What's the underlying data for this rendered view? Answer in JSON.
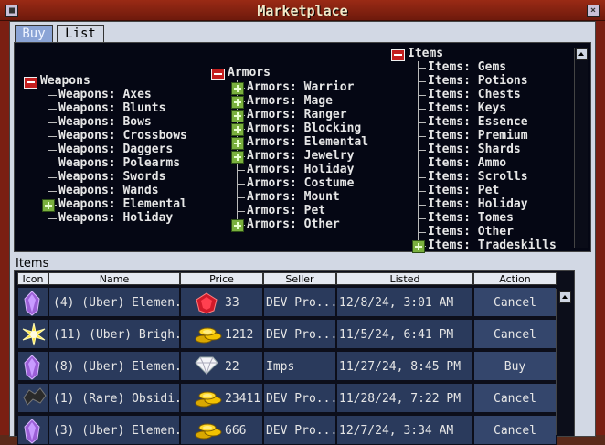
{
  "window": {
    "title": "Marketplace"
  },
  "tabs": [
    {
      "label": "Buy"
    },
    {
      "label": "List"
    }
  ],
  "tree": {
    "weapons": {
      "label": "Weapons",
      "children": [
        "Weapons: Axes",
        "Weapons: Blunts",
        "Weapons: Bows",
        "Weapons: Crossbows",
        "Weapons: Daggers",
        "Weapons: Polearms",
        "Weapons: Swords",
        "Weapons: Wands",
        "Weapons: Elemental",
        "Weapons: Holiday"
      ]
    },
    "armors": {
      "label": "Armors",
      "children": [
        "Armors: Warrior",
        "Armors: Mage",
        "Armors: Ranger",
        "Armors: Blocking",
        "Armors: Elemental",
        "Armors: Jewelry",
        "Armors: Holiday",
        "Armors: Costume",
        "Armors: Mount",
        "Armors: Pet",
        "Armors: Other"
      ]
    },
    "items": {
      "label": "Items",
      "children": [
        "Items: Gems",
        "Items: Potions",
        "Items: Chests",
        "Items: Keys",
        "Items: Essence",
        "Items: Premium",
        "Items: Shards",
        "Items: Ammo",
        "Items: Scrolls",
        "Items: Pet",
        "Items: Holiday",
        "Items: Tomes",
        "Items: Other",
        "Items: Tradeskills"
      ]
    }
  },
  "items_section": {
    "label": "Items"
  },
  "table": {
    "headers": {
      "icon": "Icon",
      "name": "Name",
      "price": "Price",
      "seller": "Seller",
      "listed": "Listed",
      "action": "Action"
    },
    "rows": [
      {
        "icon": "purple-crystal-icon",
        "name": "(4) (Uber) Elemen...",
        "price_icon": "red-gem-icon",
        "price": "33",
        "seller": "DEV Pro...",
        "listed": "12/8/24, 3:01 AM",
        "action": "Cancel"
      },
      {
        "icon": "yellow-star-icon",
        "name": "(11) (Uber) Brigh...",
        "price_icon": "gold-coins-icon",
        "price": "1212",
        "seller": "DEV Pro...",
        "listed": "11/5/24, 6:41 PM",
        "action": "Cancel"
      },
      {
        "icon": "purple-crystal-icon",
        "name": "(8) (Uber) Elemen...",
        "price_icon": "diamond-icon",
        "price": "22",
        "seller": "Imps",
        "listed": "11/27/24, 8:45 PM",
        "action": "Buy"
      },
      {
        "icon": "dark-shard-icon",
        "name": "(1) (Rare) Obsidi...",
        "price_icon": "gold-coins-icon",
        "price": "23411...",
        "seller": "DEV Pro...",
        "listed": "11/28/24, 7:22 PM",
        "action": "Cancel"
      },
      {
        "icon": "purple-crystal-icon",
        "name": "(3) (Uber) Elemen...",
        "price_icon": "gold-coins-icon",
        "price": "666",
        "seller": "DEV Pro...",
        "listed": "12/7/24, 3:34 AM",
        "action": "Cancel"
      }
    ]
  },
  "colors": {
    "title_bar": "#8a2414",
    "tree_bg": "#050714",
    "row_bg": "#2a3a5c",
    "tab_active": "#8ba4d6"
  }
}
